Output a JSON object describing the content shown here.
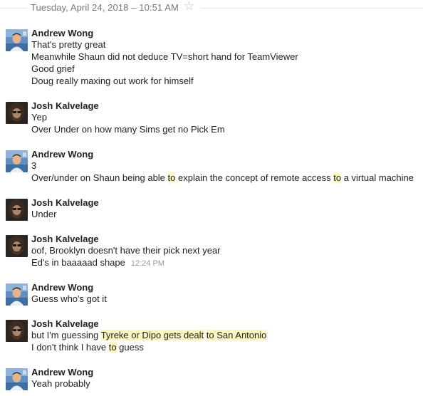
{
  "header": {
    "date": "Tuesday, April 24, 2018",
    "separator": "–",
    "time": "10:51 AM",
    "star_glyph": "☆"
  },
  "colors": {
    "highlight": "#fbf6c0",
    "name_text": "#222222",
    "meta_text": "#777777",
    "timestamp_text": "#999999"
  },
  "messages": [
    {
      "sender": "Andrew Wong",
      "avatar_icon": "andrew-wong-avatar",
      "lines": [
        "That's pretty great",
        "Meanwhile Shaun did not deduce TV=short hand for TeamViewer",
        "Good grief",
        "Doug really maxing out work for himself"
      ]
    },
    {
      "sender": "Josh Kalvelage",
      "avatar_icon": "josh-kalvelage-avatar",
      "lines": [
        "Yep",
        "Over Under on how many Sims get no Pick Em"
      ]
    },
    {
      "sender": "Andrew Wong",
      "avatar_icon": "andrew-wong-avatar",
      "lines": [
        "3",
        {
          "segments": [
            "Over/under on Shaun being able ",
            "to",
            " explain the concept of remote access ",
            "to",
            " a virtual machine"
          ]
        }
      ]
    },
    {
      "sender": "Josh Kalvelage",
      "avatar_icon": "josh-kalvelage-avatar",
      "lines": [
        "Under"
      ]
    },
    {
      "sender": "Josh Kalvelage",
      "avatar_icon": "josh-kalvelage-avatar",
      "lines": [
        "oof, Brooklyn doesn't have their pick next year",
        {
          "text": "Ed's in baaaaad shape",
          "timestamp": "12:24 PM"
        }
      ]
    },
    {
      "sender": "Andrew Wong",
      "avatar_icon": "andrew-wong-avatar",
      "lines": [
        "Guess who's got it"
      ]
    },
    {
      "sender": "Josh Kalvelage",
      "avatar_icon": "josh-kalvelage-avatar",
      "lines": [
        {
          "segments": [
            "but I'm guessing ",
            "Tyreke or Dipo gets dealt",
            " ",
            "to San Antonio"
          ]
        },
        {
          "segments": [
            "I don't think I have ",
            "to",
            " guess"
          ]
        }
      ]
    },
    {
      "sender": "Andrew Wong",
      "avatar_icon": "andrew-wong-avatar",
      "lines": [
        "Yeah probably"
      ]
    }
  ]
}
